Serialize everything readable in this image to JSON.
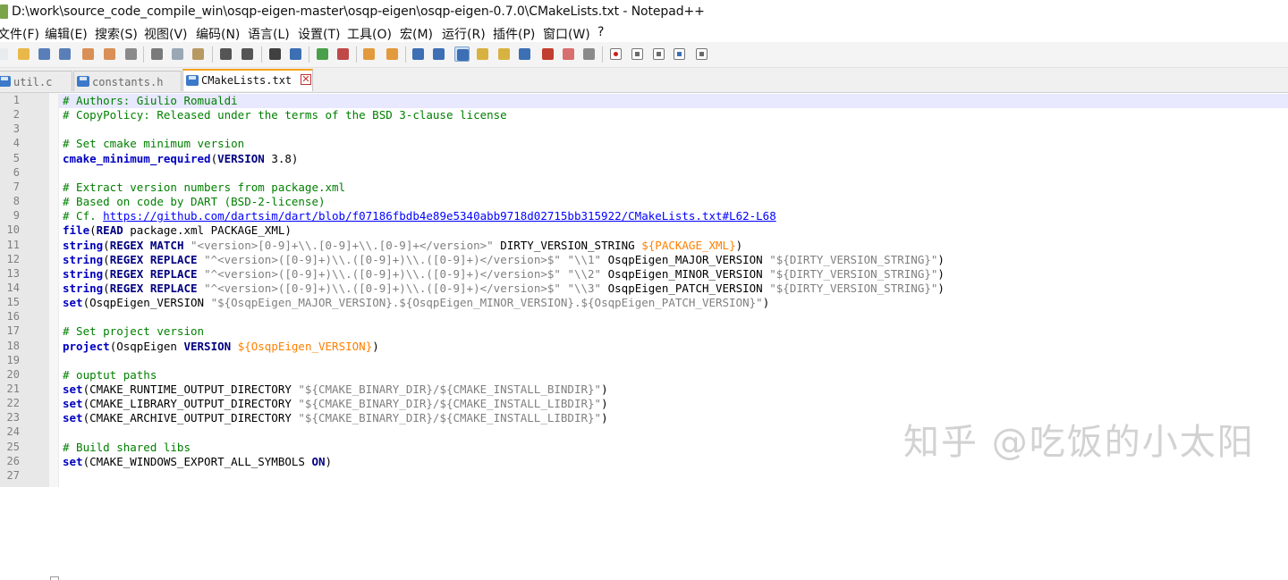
{
  "window": {
    "title": "D:\\work\\source_code_compile_win\\osqp-eigen-master\\osqp-eigen\\osqp-eigen-0.7.0\\CMakeLists.txt - Notepad++"
  },
  "menu": [
    {
      "label": "文件(F)"
    },
    {
      "label": "编辑(E)"
    },
    {
      "label": "搜索(S)"
    },
    {
      "label": "视图(V)"
    },
    {
      "label": "编码(N)"
    },
    {
      "label": "语言(L)"
    },
    {
      "label": "设置(T)"
    },
    {
      "label": "工具(O)"
    },
    {
      "label": "宏(M)"
    },
    {
      "label": "运行(R)"
    },
    {
      "label": "插件(P)"
    },
    {
      "label": "窗口(W)"
    },
    {
      "label": "?"
    }
  ],
  "toolbar": {
    "buttons": [
      {
        "name": "new-file-icon",
        "color": "#e9ecef"
      },
      {
        "name": "open-file-icon",
        "color": "#e8b84a"
      },
      {
        "name": "save-icon",
        "color": "#5a7fb8"
      },
      {
        "name": "save-all-icon",
        "color": "#5a7fb8"
      },
      {
        "name": "close-icon",
        "color": "#d98f55"
      },
      {
        "name": "close-all-icon",
        "color": "#d98f55"
      },
      {
        "name": "print-icon",
        "color": "#8a8a8a"
      },
      {
        "name": "cut-icon",
        "color": "#7a7a7a"
      },
      {
        "name": "copy-icon",
        "color": "#9aa7b5"
      },
      {
        "name": "paste-icon",
        "color": "#b79a63"
      },
      {
        "name": "undo-icon",
        "color": "#555555"
      },
      {
        "name": "redo-icon",
        "color": "#555555"
      },
      {
        "name": "find-icon",
        "color": "#404040"
      },
      {
        "name": "replace-icon",
        "color": "#3d6fb4"
      },
      {
        "name": "zoom-in-icon",
        "color": "#4aa04a"
      },
      {
        "name": "zoom-out-icon",
        "color": "#c04848"
      },
      {
        "name": "sync-vertical-icon",
        "color": "#e39a3c"
      },
      {
        "name": "sync-horizontal-icon",
        "color": "#e39a3c"
      },
      {
        "name": "word-wrap-icon",
        "color": "#3d6fb4"
      },
      {
        "name": "show-all-chars-icon",
        "color": "#3d6fb4"
      },
      {
        "name": "indent-guide-icon",
        "color": "#3d6fb4",
        "active": true
      },
      {
        "name": "user-language-icon",
        "color": "#d8b240"
      },
      {
        "name": "doc-map-icon",
        "color": "#d8b240"
      },
      {
        "name": "function-list-icon",
        "color": "#3d6fb4"
      },
      {
        "name": "folder-workspace-icon",
        "color": "#c23e2e"
      },
      {
        "name": "monitoring-icon",
        "color": "#d86e6e"
      },
      {
        "name": "view-icon",
        "color": "#8a8a8a"
      },
      {
        "name": "record-macro-icon",
        "color": "#cc1f1f"
      },
      {
        "name": "stop-macro-icon",
        "color": "#6a6a6a"
      },
      {
        "name": "play-macro-icon",
        "color": "#6a6a6a"
      },
      {
        "name": "run-macro-multiple-icon",
        "color": "#3d6fb4"
      },
      {
        "name": "save-macro-icon",
        "color": "#6a6a6a"
      }
    ]
  },
  "tabs": [
    {
      "label": "util.c",
      "active": false
    },
    {
      "label": "constants.h",
      "active": false
    },
    {
      "label": "CMakeLists.txt",
      "active": true
    }
  ],
  "editor": {
    "current_line": 1,
    "lines": [
      {
        "n": "1",
        "tokens": [
          {
            "t": "# Authors: Giulio Romualdi",
            "c": "comment"
          }
        ]
      },
      {
        "n": "2",
        "tokens": [
          {
            "t": "# CopyPolicy: Released under the terms of the BSD 3-clause license",
            "c": "comment"
          }
        ]
      },
      {
        "n": "3",
        "tokens": []
      },
      {
        "n": "4",
        "tokens": [
          {
            "t": "# Set cmake minimum version",
            "c": "comment"
          }
        ]
      },
      {
        "n": "5",
        "tokens": [
          {
            "t": "cmake_minimum_required",
            "c": "cmd"
          },
          {
            "t": "(",
            "c": "text"
          },
          {
            "t": "VERSION",
            "c": "kw"
          },
          {
            "t": " 3.8)",
            "c": "text"
          }
        ]
      },
      {
        "n": "6",
        "tokens": []
      },
      {
        "n": "7",
        "tokens": [
          {
            "t": "# Extract version numbers from package.xml",
            "c": "comment"
          }
        ]
      },
      {
        "n": "8",
        "tokens": [
          {
            "t": "# Based on code by DART (BSD-2-license)",
            "c": "comment"
          }
        ]
      },
      {
        "n": "9",
        "tokens": [
          {
            "t": "# Cf. ",
            "c": "comment"
          },
          {
            "t": "https://github.com/dartsim/dart/blob/f07186fbdb4e89e5340abb9718d02715bb315922/CMakeLists.txt#L62-L68",
            "c": "url"
          }
        ]
      },
      {
        "n": "10",
        "tokens": [
          {
            "t": "file",
            "c": "cmd"
          },
          {
            "t": "(",
            "c": "text"
          },
          {
            "t": "READ",
            "c": "kw"
          },
          {
            "t": " package.xml PACKAGE_XML)",
            "c": "text"
          }
        ]
      },
      {
        "n": "11",
        "tokens": [
          {
            "t": "string",
            "c": "cmd"
          },
          {
            "t": "(",
            "c": "text"
          },
          {
            "t": "REGEX MATCH",
            "c": "kw"
          },
          {
            "t": " ",
            "c": "text"
          },
          {
            "t": "\"<version>[0-9]+\\\\.[0-9]+\\\\.[0-9]+</version>\"",
            "c": "str"
          },
          {
            "t": " DIRTY_VERSION_STRING ",
            "c": "text"
          },
          {
            "t": "${PACKAGE_XML}",
            "c": "var"
          },
          {
            "t": ")",
            "c": "text"
          }
        ]
      },
      {
        "n": "12",
        "tokens": [
          {
            "t": "string",
            "c": "cmd"
          },
          {
            "t": "(",
            "c": "text"
          },
          {
            "t": "REGEX REPLACE",
            "c": "kw"
          },
          {
            "t": " ",
            "c": "text"
          },
          {
            "t": "\"^<version>([0-9]+)\\\\.([0-9]+)\\\\.([0-9]+)</version>$\"",
            "c": "str"
          },
          {
            "t": " ",
            "c": "text"
          },
          {
            "t": "\"\\\\1\"",
            "c": "str"
          },
          {
            "t": " OsqpEigen_MAJOR_VERSION ",
            "c": "text"
          },
          {
            "t": "\"${DIRTY_VERSION_STRING}\"",
            "c": "str"
          },
          {
            "t": ")",
            "c": "text"
          }
        ]
      },
      {
        "n": "13",
        "tokens": [
          {
            "t": "string",
            "c": "cmd"
          },
          {
            "t": "(",
            "c": "text"
          },
          {
            "t": "REGEX REPLACE",
            "c": "kw"
          },
          {
            "t": " ",
            "c": "text"
          },
          {
            "t": "\"^<version>([0-9]+)\\\\.([0-9]+)\\\\.([0-9]+)</version>$\"",
            "c": "str"
          },
          {
            "t": " ",
            "c": "text"
          },
          {
            "t": "\"\\\\2\"",
            "c": "str"
          },
          {
            "t": " OsqpEigen_MINOR_VERSION ",
            "c": "text"
          },
          {
            "t": "\"${DIRTY_VERSION_STRING}\"",
            "c": "str"
          },
          {
            "t": ")",
            "c": "text"
          }
        ]
      },
      {
        "n": "14",
        "tokens": [
          {
            "t": "string",
            "c": "cmd"
          },
          {
            "t": "(",
            "c": "text"
          },
          {
            "t": "REGEX REPLACE",
            "c": "kw"
          },
          {
            "t": " ",
            "c": "text"
          },
          {
            "t": "\"^<version>([0-9]+)\\\\.([0-9]+)\\\\.([0-9]+)</version>$\"",
            "c": "str"
          },
          {
            "t": " ",
            "c": "text"
          },
          {
            "t": "\"\\\\3\"",
            "c": "str"
          },
          {
            "t": " OsqpEigen_PATCH_VERSION ",
            "c": "text"
          },
          {
            "t": "\"${DIRTY_VERSION_STRING}\"",
            "c": "str"
          },
          {
            "t": ")",
            "c": "text"
          }
        ]
      },
      {
        "n": "15",
        "tokens": [
          {
            "t": "set",
            "c": "cmd"
          },
          {
            "t": "(OsqpEigen_VERSION ",
            "c": "text"
          },
          {
            "t": "\"${OsqpEigen_MAJOR_VERSION}.${OsqpEigen_MINOR_VERSION}.${OsqpEigen_PATCH_VERSION}\"",
            "c": "str"
          },
          {
            "t": ")",
            "c": "text"
          }
        ]
      },
      {
        "n": "16",
        "tokens": []
      },
      {
        "n": "17",
        "tokens": [
          {
            "t": "# Set project version",
            "c": "comment"
          }
        ]
      },
      {
        "n": "18",
        "tokens": [
          {
            "t": "project",
            "c": "cmd"
          },
          {
            "t": "(OsqpEigen ",
            "c": "text"
          },
          {
            "t": "VERSION",
            "c": "kw"
          },
          {
            "t": " ",
            "c": "text"
          },
          {
            "t": "${OsqpEigen_VERSION}",
            "c": "var"
          },
          {
            "t": ")",
            "c": "text"
          }
        ]
      },
      {
        "n": "19",
        "tokens": []
      },
      {
        "n": "20",
        "tokens": [
          {
            "t": "# ouptut paths",
            "c": "comment"
          }
        ]
      },
      {
        "n": "21",
        "tokens": [
          {
            "t": "set",
            "c": "cmd"
          },
          {
            "t": "(CMAKE_RUNTIME_OUTPUT_DIRECTORY ",
            "c": "text"
          },
          {
            "t": "\"${CMAKE_BINARY_DIR}/${CMAKE_INSTALL_BINDIR}\"",
            "c": "str"
          },
          {
            "t": ")",
            "c": "text"
          }
        ]
      },
      {
        "n": "22",
        "tokens": [
          {
            "t": "set",
            "c": "cmd"
          },
          {
            "t": "(CMAKE_LIBRARY_OUTPUT_DIRECTORY ",
            "c": "text"
          },
          {
            "t": "\"${CMAKE_BINARY_DIR}/${CMAKE_INSTALL_LIBDIR}\"",
            "c": "str"
          },
          {
            "t": ")",
            "c": "text"
          }
        ]
      },
      {
        "n": "23",
        "tokens": [
          {
            "t": "set",
            "c": "cmd"
          },
          {
            "t": "(CMAKE_ARCHIVE_OUTPUT_DIRECTORY ",
            "c": "text"
          },
          {
            "t": "\"${CMAKE_BINARY_DIR}/${CMAKE_INSTALL_LIBDIR}\"",
            "c": "str"
          },
          {
            "t": ")",
            "c": "text"
          }
        ]
      },
      {
        "n": "24",
        "tokens": []
      },
      {
        "n": "25",
        "tokens": [
          {
            "t": "# Build shared libs",
            "c": "comment"
          }
        ]
      },
      {
        "n": "26",
        "tokens": [
          {
            "t": "set",
            "c": "cmd"
          },
          {
            "t": "(CMAKE_WINDOWS_EXPORT_ALL_SYMBOLS ",
            "c": "text"
          },
          {
            "t": "ON",
            "c": "kw"
          },
          {
            "t": ")",
            "c": "text"
          }
        ]
      },
      {
        "n": "27",
        "tokens": []
      }
    ]
  },
  "watermark": {
    "text": "知乎 @吃饭的小太阳"
  }
}
